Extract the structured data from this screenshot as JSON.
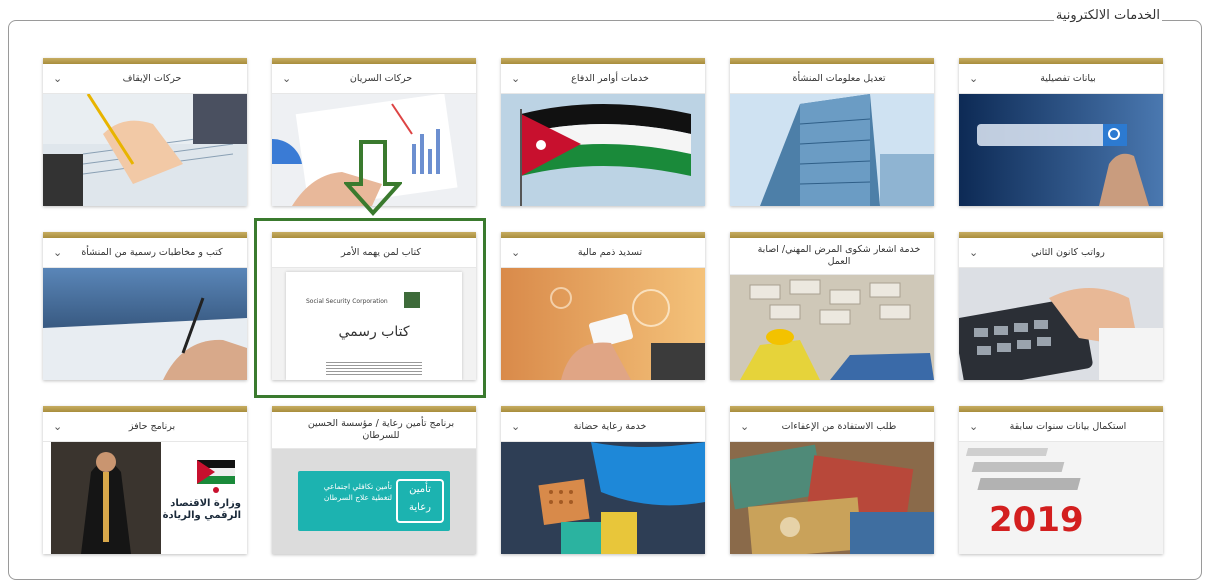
{
  "section_title": "الخدمات الالكترونية",
  "cards": [
    {
      "key": "details",
      "title": "بيانات تفصيلية",
      "has_chevron": true
    },
    {
      "key": "facility_info",
      "title": "تعديل معلومات المنشأة",
      "has_chevron": false
    },
    {
      "key": "defense_orders",
      "title": "خدمات أوامر الدفاع",
      "has_chevron": true
    },
    {
      "key": "validity",
      "title": "حركات السريان",
      "has_chevron": true
    },
    {
      "key": "suspension",
      "title": "حركات الإيقاف",
      "has_chevron": true
    },
    {
      "key": "january_salaries",
      "title": "رواتب كانون الثاني",
      "has_chevron": true
    },
    {
      "key": "occupational_disease",
      "title": "خدمة اشعار شكوى المرض المهني/ اصابة العمل",
      "has_chevron": false
    },
    {
      "key": "financial_dues",
      "title": "تسديد ذمم مالية",
      "has_chevron": true
    },
    {
      "key": "to_whom_it_may_concern",
      "title": "كتاب لمن يهمه الأمر",
      "has_chevron": false,
      "image_text": "كتاب رسمي",
      "image_caption": "Social Security Corporation"
    },
    {
      "key": "official_letters",
      "title": "كتب و مخاطبات رسمية من المنشأة",
      "has_chevron": true
    },
    {
      "key": "previous_years",
      "title": "استكمال بيانات سنوات سابقة",
      "has_chevron": true,
      "image_text": "2019"
    },
    {
      "key": "exemptions",
      "title": "طلب الاستفادة من الإعفاءات",
      "has_chevron": true
    },
    {
      "key": "childcare",
      "title": "خدمة رعاية حضانة",
      "has_chevron": true
    },
    {
      "key": "reaya",
      "title": "برنامج تأمين رعاية / مؤسسة الحسين للسرطان",
      "has_chevron": false,
      "image_text": "تأمين رعاية",
      "image_caption": "تأمين تكافلي اجتماعي لتغطية علاج السرطان"
    },
    {
      "key": "hafez",
      "title": "برنامج حافز",
      "has_chevron": true,
      "image_text": "وزارة الاقتصاد الرقمي والريادة"
    }
  ],
  "chevron_glyph": "⌄",
  "highlight_color": "#3a7a2e",
  "accent_gold": "#b89a4c"
}
